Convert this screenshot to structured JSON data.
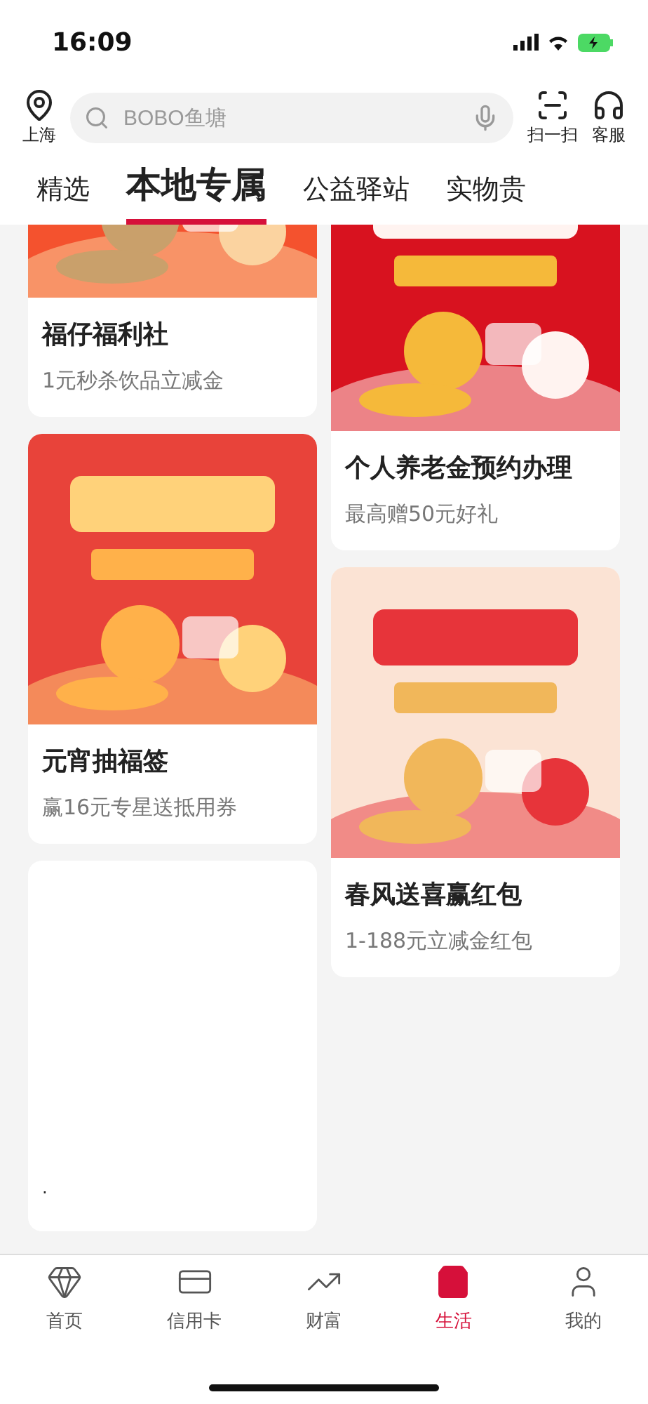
{
  "status_bar": {
    "time": "16:09"
  },
  "header": {
    "location": "上海",
    "search": {
      "placeholder": "BOBO鱼塘"
    },
    "actions": [
      {
        "label": "扫一扫"
      },
      {
        "label": "客服"
      }
    ]
  },
  "tabs": [
    {
      "label": "精选",
      "selected": false
    },
    {
      "label": "本地专属",
      "selected": true
    },
    {
      "label": "公益驿站",
      "selected": false
    },
    {
      "label": "实物贵",
      "selected": false
    }
  ],
  "columns": [
    [
      {
        "kind": "promo",
        "title": "福仔福利社",
        "subtitle": "1元秒杀饮品立减金"
      },
      {
        "kind": "promo",
        "title": "元宵抽福签",
        "subtitle": "赢16元专星送抵用券"
      },
      {
        "kind": "blank",
        "note": "."
      }
    ],
    [
      {
        "kind": "promo",
        "title": "个人养老金预约办理",
        "subtitle": "最高赠50元好礼"
      },
      {
        "kind": "promo",
        "title": "春风送喜赢红包",
        "subtitle": "1-188元立减金红包"
      }
    ]
  ],
  "bottom_nav": [
    {
      "label": "首页",
      "selected": false
    },
    {
      "label": "信用卡",
      "selected": false
    },
    {
      "label": "财富",
      "selected": false
    },
    {
      "label": "生活",
      "selected": true
    },
    {
      "label": "我的",
      "selected": false
    }
  ]
}
